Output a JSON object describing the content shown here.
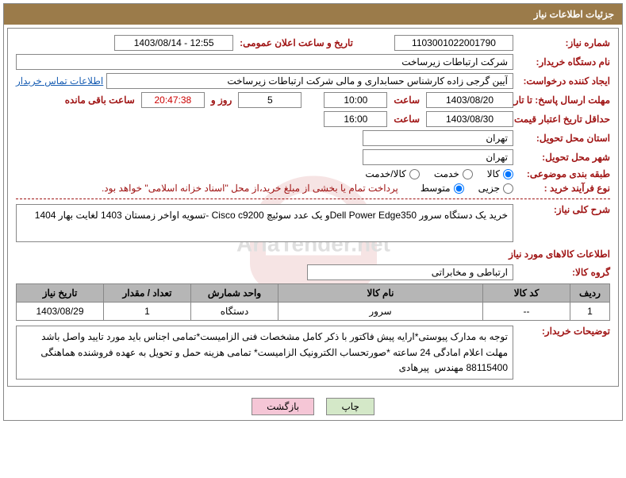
{
  "header": {
    "title": "جزئیات اطلاعات نیاز"
  },
  "need_number": {
    "label": "شماره نیاز:",
    "value": "1103001022001790"
  },
  "announce": {
    "label": "تاریخ و ساعت اعلان عمومی:",
    "value": "1403/08/14 - 12:55"
  },
  "buyer_org": {
    "label": "نام دستگاه خریدار:",
    "value": "شرکت ارتباطات زیرساخت"
  },
  "requester": {
    "label": "ایجاد کننده درخواست:",
    "value": "آیین گرجی زاده کارشناس حسابداری و مالی شرکت ارتباطات زیرساخت",
    "contact_link": "اطلاعات تماس خریدار"
  },
  "deadline_send": {
    "label": "مهلت ارسال پاسخ: تا تاریخ:",
    "date": "1403/08/20",
    "time_label": "ساعت",
    "time": "10:00",
    "days": "5",
    "days_label": "روز و",
    "countdown": "20:47:38",
    "remaining_label": "ساعت باقی مانده"
  },
  "deadline_price": {
    "label": "حداقل تاریخ اعتبار قیمت: تا تاریخ:",
    "date": "1403/08/30",
    "time_label": "ساعت",
    "time": "16:00"
  },
  "province": {
    "label": "استان محل تحویل:",
    "value": "تهران"
  },
  "city": {
    "label": "شهر محل تحویل:",
    "value": "تهران"
  },
  "subject_class": {
    "label": "طبقه بندی موضوعی:",
    "opts": [
      "کالا",
      "خدمت",
      "کالا/خدمت"
    ]
  },
  "purchase_type": {
    "label": "نوع فرآیند خرید :",
    "opts": [
      "جزیی",
      "متوسط"
    ],
    "note": "پرداخت تمام یا بخشی از مبلغ خرید،از محل \"اسناد خزانه اسلامی\" خواهد بود."
  },
  "summary": {
    "label": "شرح کلی نیاز:",
    "text": "خرید یک دستگاه سرور Dell Power Edge350و یک عدد سوئیچ Cisco c9200 -تسویه اواخر زمستان 1403 لغایت بهار 1404"
  },
  "goods_info_title": "اطلاعات کالاهای مورد نیاز",
  "goods_group": {
    "label": "گروه کالا:",
    "value": "ارتباطی و مخابراتی"
  },
  "table": {
    "headers": [
      "ردیف",
      "کد کالا",
      "نام کالا",
      "واحد شمارش",
      "تعداد / مقدار",
      "تاریخ نیاز"
    ],
    "row": {
      "idx": "1",
      "code": "--",
      "name": "سرور",
      "unit": "دستگاه",
      "qty": "1",
      "date": "1403/08/29"
    }
  },
  "buyer_notes": {
    "label": "توضیحات خریدار:",
    "text": "توجه به مدارک پیوستی*ارایه پیش فاکتور با ذکر کامل مشخصات فنی الزامیست*تمامی اجناس باید مورد تایید واصل باشد مهلت اعلام امادگی 24 ساعته *صورتحساب الکترونیک الزامیست* تمامی هزینه حمل و تحویل به عهده فروشنده هماهنگی 88115400 مهندس  پیرهادی"
  },
  "buttons": {
    "print": "چاپ",
    "back": "بازگشت"
  }
}
